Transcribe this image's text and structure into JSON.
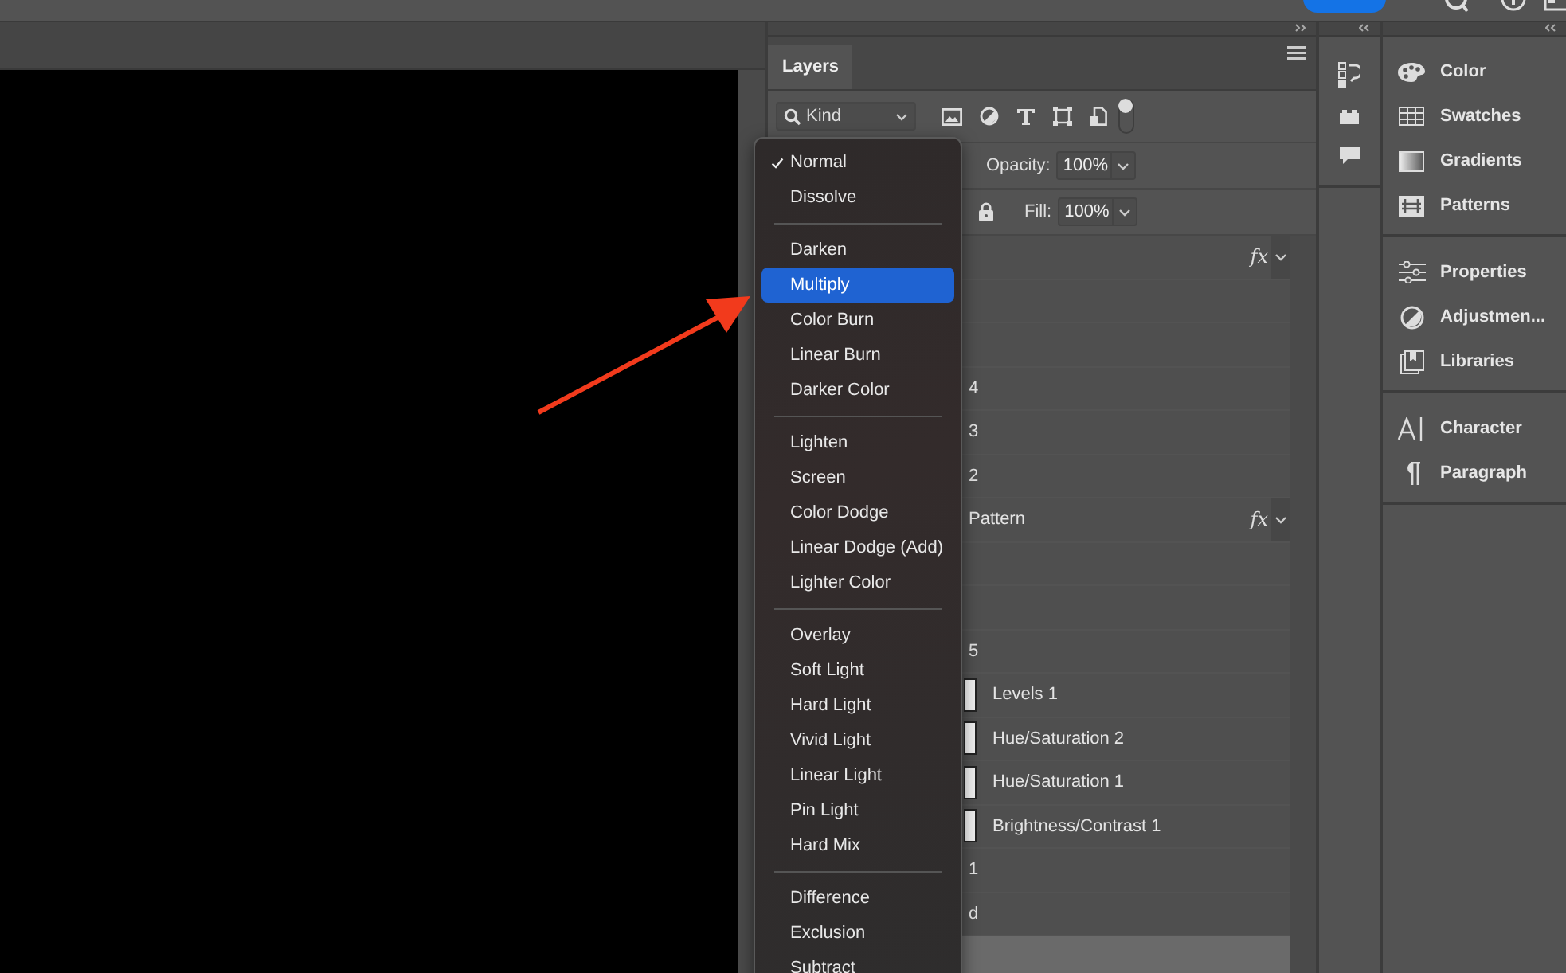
{
  "layers_panel": {
    "tab": "Layers",
    "filter": {
      "value": "Kind"
    },
    "opacity": {
      "label": "Opacity:",
      "value": "100%"
    },
    "fill": {
      "label": "Fill:",
      "value": "100%"
    },
    "layers": [
      {
        "kind": "group",
        "fx": "fx",
        "selected": false
      },
      {
        "kind": "layer",
        "selected": false
      },
      {
        "kind": "layer",
        "selected": false
      },
      {
        "kind": "layer",
        "name": "4",
        "selected": false
      },
      {
        "kind": "layer",
        "name": "3",
        "selected": false
      },
      {
        "kind": "layer",
        "name": "2",
        "selected": false
      },
      {
        "kind": "layer",
        "name": "Pattern",
        "fx": "fx",
        "selected": false
      },
      {
        "kind": "layer",
        "selected": false
      },
      {
        "kind": "layer",
        "selected": false
      },
      {
        "kind": "layer",
        "name": "5",
        "selected": false
      },
      {
        "kind": "adjustment",
        "name": "Levels 1",
        "selected": false
      },
      {
        "kind": "adjustment",
        "name": "Hue/Saturation 2",
        "selected": false
      },
      {
        "kind": "adjustment",
        "name": "Hue/Saturation 1",
        "selected": false
      },
      {
        "kind": "adjustment",
        "name": "Brightness/Contrast 1",
        "selected": false
      },
      {
        "kind": "layer",
        "name": "1",
        "selected": false
      },
      {
        "kind": "layer",
        "name": "d",
        "selected": false
      },
      {
        "kind": "layer",
        "selected": true
      }
    ]
  },
  "blend_menu": {
    "groups": [
      [
        {
          "label": "Normal",
          "checked": true,
          "selected": false
        },
        {
          "label": "Dissolve",
          "checked": false,
          "selected": false
        }
      ],
      [
        {
          "label": "Darken",
          "checked": false,
          "selected": false
        },
        {
          "label": "Multiply",
          "checked": false,
          "selected": true
        },
        {
          "label": "Color Burn",
          "checked": false,
          "selected": false
        },
        {
          "label": "Linear Burn",
          "checked": false,
          "selected": false
        },
        {
          "label": "Darker Color",
          "checked": false,
          "selected": false
        }
      ],
      [
        {
          "label": "Lighten",
          "checked": false,
          "selected": false
        },
        {
          "label": "Screen",
          "checked": false,
          "selected": false
        },
        {
          "label": "Color Dodge",
          "checked": false,
          "selected": false
        },
        {
          "label": "Linear Dodge (Add)",
          "checked": false,
          "selected": false
        },
        {
          "label": "Lighter Color",
          "checked": false,
          "selected": false
        }
      ],
      [
        {
          "label": "Overlay",
          "checked": false,
          "selected": false
        },
        {
          "label": "Soft Light",
          "checked": false,
          "selected": false
        },
        {
          "label": "Hard Light",
          "checked": false,
          "selected": false
        },
        {
          "label": "Vivid Light",
          "checked": false,
          "selected": false
        },
        {
          "label": "Linear Light",
          "checked": false,
          "selected": false
        },
        {
          "label": "Pin Light",
          "checked": false,
          "selected": false
        },
        {
          "label": "Hard Mix",
          "checked": false,
          "selected": false
        }
      ],
      [
        {
          "label": "Difference",
          "checked": false,
          "selected": false
        },
        {
          "label": "Exclusion",
          "checked": false,
          "selected": false
        },
        {
          "label": "Subtract",
          "checked": false,
          "selected": false
        }
      ]
    ]
  },
  "side_panels": [
    [
      {
        "label": "Color"
      },
      {
        "label": "Swatches"
      },
      {
        "label": "Gradients"
      },
      {
        "label": "Patterns"
      }
    ],
    [
      {
        "label": "Properties"
      },
      {
        "label": "Adjustmen..."
      },
      {
        "label": "Libraries"
      }
    ],
    [
      {
        "label": "Character"
      },
      {
        "label": "Paragraph"
      }
    ]
  ]
}
